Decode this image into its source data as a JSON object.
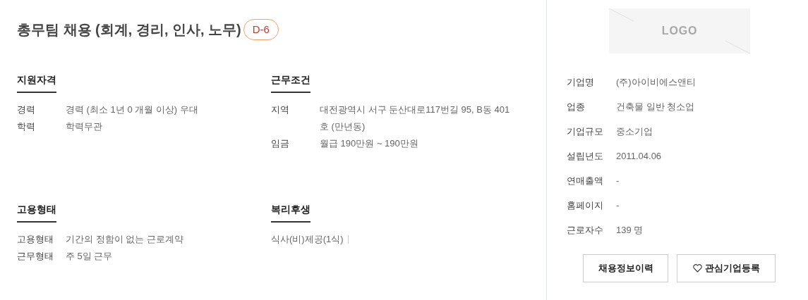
{
  "title": "총무팀 채용 (회계, 경리, 인사, 노무)",
  "deadline_badge": "D-6",
  "sections": [
    {
      "heading": "지원자격",
      "rows": [
        {
          "label": "경력",
          "value": "경력 (최소 1년 0 개월 이상) 우대"
        },
        {
          "label": "학력",
          "value": "학력무관"
        }
      ]
    },
    {
      "heading": "근무조건",
      "rows": [
        {
          "label": "지역",
          "value": "대전광역시 서구 둔산대로117번길 95, B동 401호 (만년동)"
        },
        {
          "label": "임금",
          "value": "월급 190만원 ~ 190만원"
        }
      ]
    },
    {
      "heading": "고용형태",
      "rows": [
        {
          "label": "고용형태",
          "value": "기간의 정함이 없는 근로계약"
        },
        {
          "label": "근무형태",
          "value": "주 5일 근무"
        }
      ]
    },
    {
      "heading": "복리후생",
      "items": [
        "식사(비)제공(1식)"
      ]
    }
  ],
  "company": {
    "logo": "LOGO",
    "rows": [
      {
        "label": "기업명",
        "value": "(주)아이비에스앤티"
      },
      {
        "label": "업종",
        "value": "건축물 일반 청소업"
      },
      {
        "label": "기업규모",
        "value": "중소기업"
      },
      {
        "label": "설립년도",
        "value": "2011.04.06"
      },
      {
        "label": "연매출액",
        "value": "-"
      },
      {
        "label": "홈페이지",
        "value": "-"
      },
      {
        "label": "근로자수",
        "value": "139 명"
      }
    ],
    "buttons": [
      "채용정보이력",
      "관심기업등록"
    ]
  }
}
